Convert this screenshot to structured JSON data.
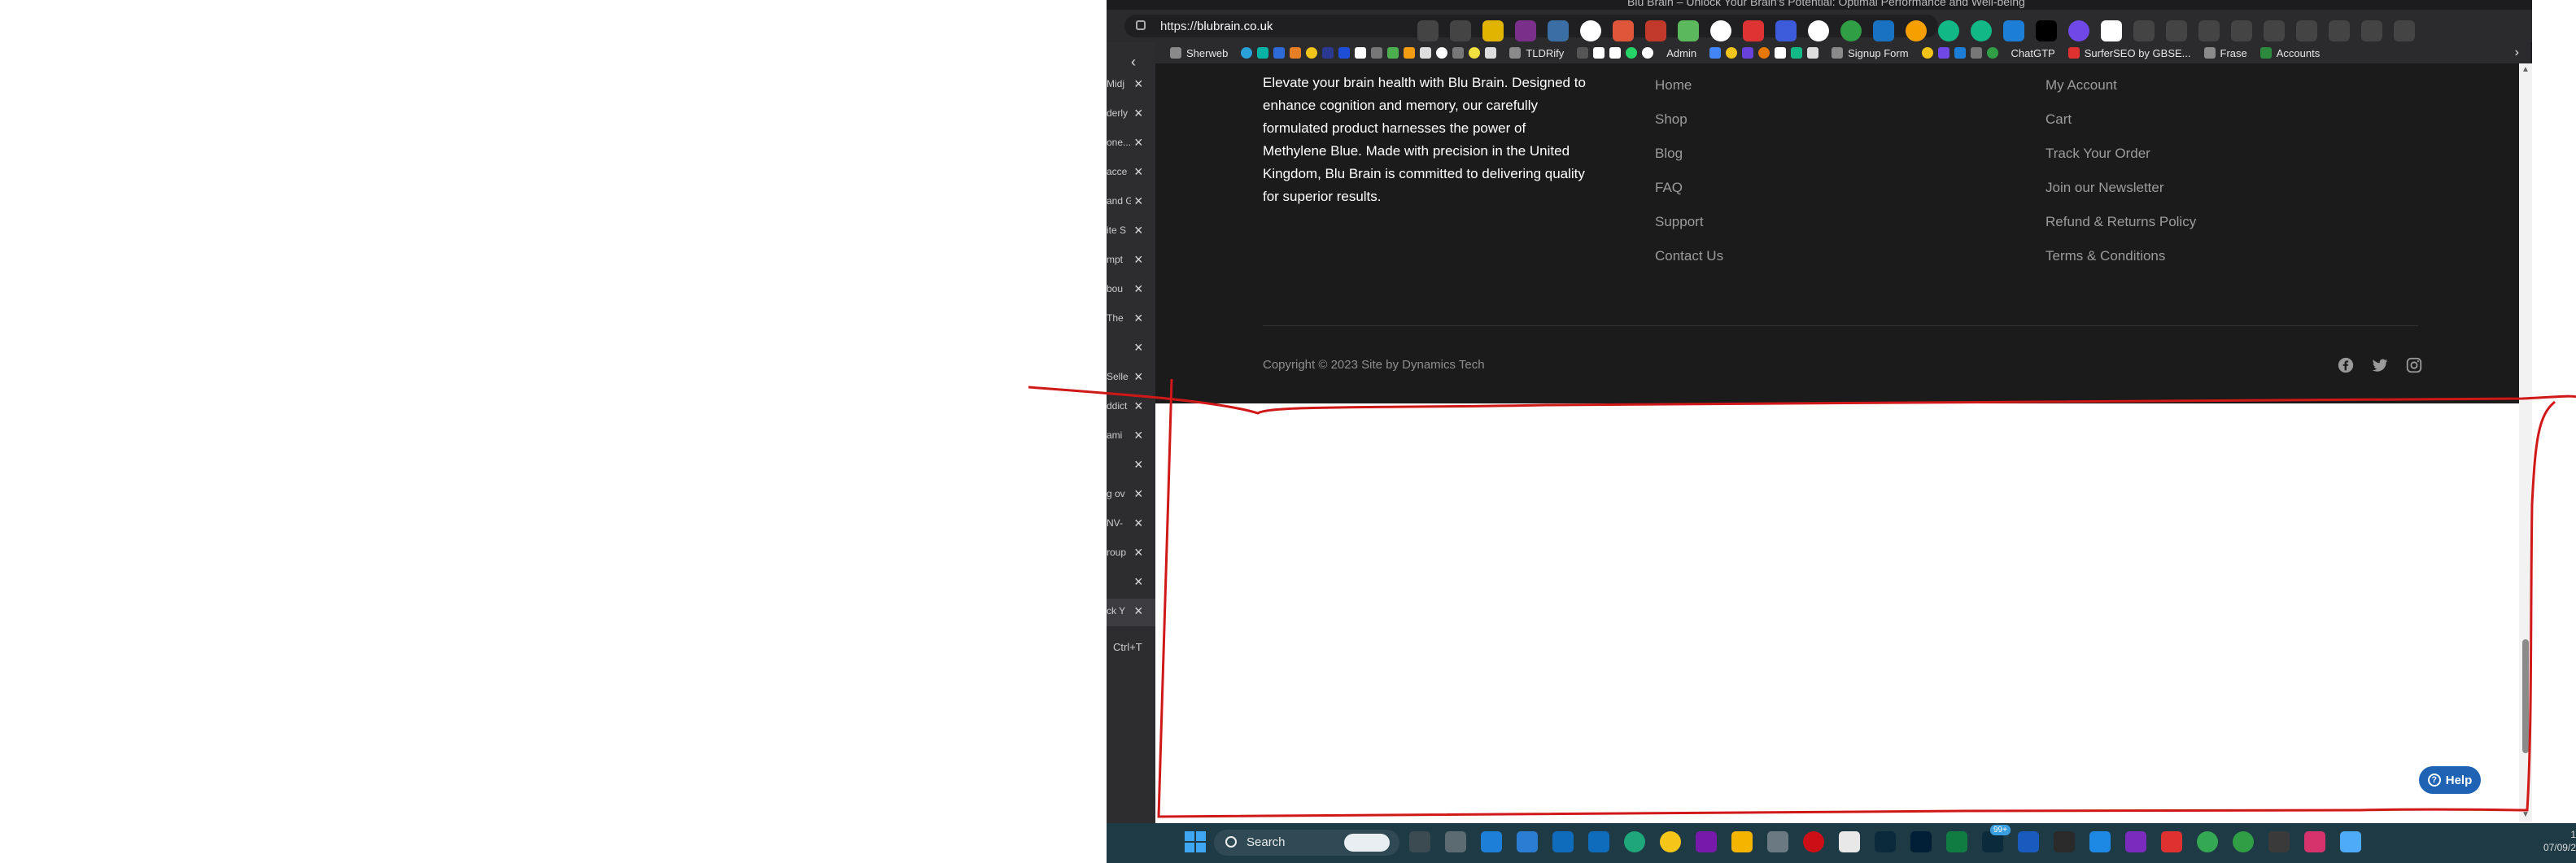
{
  "browser": {
    "title_fragment": "Blu Brain – Unlock Your Brain's Potential: Optimal Performance and Well-being",
    "url_scheme": "https://",
    "url_host": "blubrain.co.uk",
    "bookmarks": [
      "Sherweb",
      "TLDRify",
      "Admin",
      "Signup Form",
      "ChatGTP",
      "SurferSEO by GBSE...",
      "Frase",
      "Accounts"
    ],
    "vertical_tabs": [
      "Midj",
      "derly",
      "one...",
      "acce",
      "and G",
      "ite S",
      "mpt",
      "bou",
      "The",
      "",
      "Selle",
      "ddict",
      "ami",
      "",
      "g ov",
      "NV-",
      "roup",
      "",
      "ck Y"
    ],
    "new_tab_shortcut": "Ctrl+T"
  },
  "footer": {
    "about": "Elevate your brain health with Blu Brain. Designed to enhance cognition and memory, our carefully formulated product harnesses the power of Methylene Blue. Made with precision in the United Kingdom, Blu Brain is committed to delivering quality for superior results.",
    "col1": [
      "Home",
      "Shop",
      "Blog",
      "FAQ",
      "Support",
      "Contact Us"
    ],
    "col2": [
      "My Account",
      "Cart",
      "Track Your Order",
      "Join our Newsletter",
      "Refund & Returns Policy",
      "Terms & Conditions"
    ],
    "copyright": "Copyright © 2023 Site by Dynamics Tech",
    "social_icons": [
      "facebook-icon",
      "twitter-icon",
      "instagram-icon"
    ]
  },
  "help_button": {
    "label": "Help"
  },
  "taskbar": {
    "search_label": "Search",
    "notification_badge": "99+",
    "clock_date": "07/09/2"
  },
  "colors": {
    "footer_bg": "#1b1b1b",
    "help_blue": "#1f63b4",
    "annotation_red": "#d01818",
    "taskbar_bg": "#1e3a44"
  }
}
